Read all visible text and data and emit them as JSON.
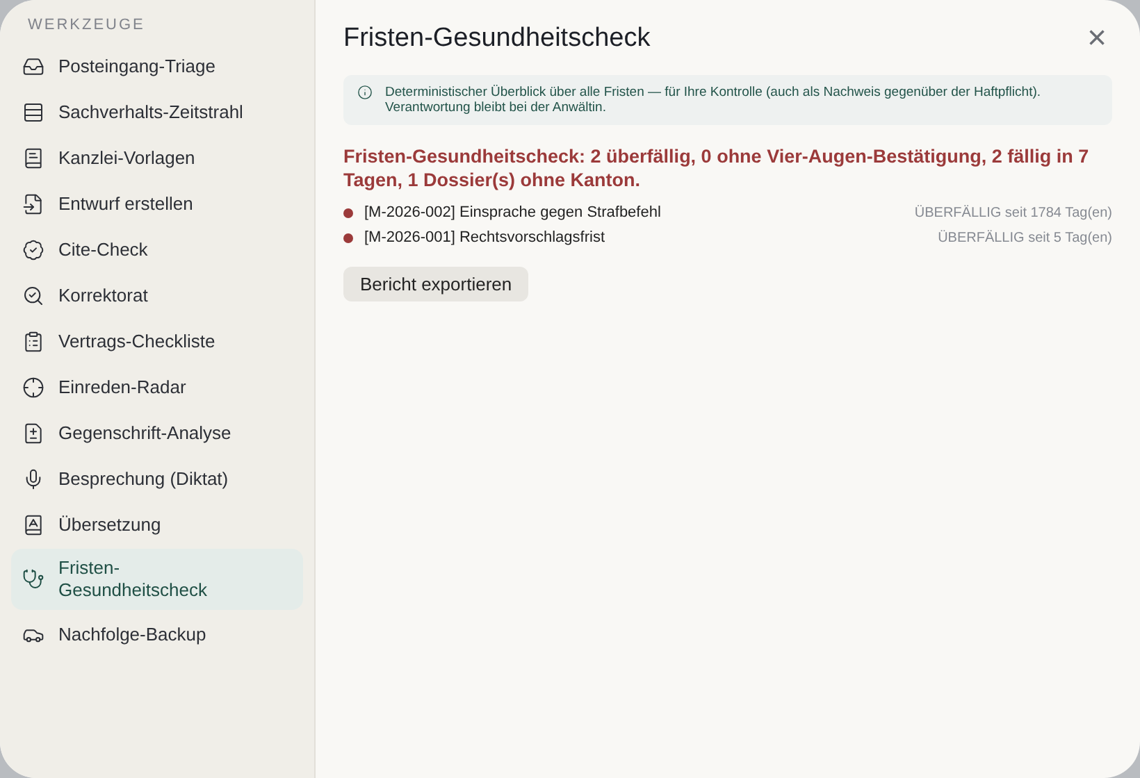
{
  "sidebar": {
    "heading": "WERKZEUGE",
    "items": [
      {
        "label": "Posteingang-Triage",
        "selected": false
      },
      {
        "label": "Sachverhalts-Zeitstrahl",
        "selected": false
      },
      {
        "label": "Kanzlei-Vorlagen",
        "selected": false
      },
      {
        "label": "Entwurf erstellen",
        "selected": false
      },
      {
        "label": "Cite-Check",
        "selected": false
      },
      {
        "label": "Korrektorat",
        "selected": false
      },
      {
        "label": "Vertrags-Checkliste",
        "selected": false
      },
      {
        "label": "Einreden-Radar",
        "selected": false
      },
      {
        "label": "Gegenschrift-Analyse",
        "selected": false
      },
      {
        "label": "Besprechung (Diktat)",
        "selected": false
      },
      {
        "label": "Übersetzung",
        "selected": false
      },
      {
        "label": "Fristen-Gesundheitscheck",
        "selected": true
      },
      {
        "label": "Nachfolge-Backup",
        "selected": false
      }
    ]
  },
  "panel": {
    "title": "Fristen-Gesundheitscheck",
    "close": "×",
    "notice": "Deterministischer Überblick über alle Fristen — für Ihre Kontrolle (auch als Nachweis gegenüber der Haftpflicht). Verantwortung bleibt bei der Anwältin.",
    "summary": "Fristen-Gesundheitscheck: 2 überfällig, 0 ohne Vier-Augen-Bestätigung, 2 fällig in 7 Tagen, 1 Dossier(s) ohne Kanton.",
    "deadlines": [
      {
        "name": "[M-2026-002] Einsprache gegen Strafbefehl",
        "status": "ÜBERFÄLLIG seit 1784 Tag(en)"
      },
      {
        "name": "[M-2026-001] Rechtsvorschlagsfrist",
        "status": "ÜBERFÄLLIG seit 5 Tag(en)"
      }
    ],
    "export_button": "Bericht exportieren"
  }
}
